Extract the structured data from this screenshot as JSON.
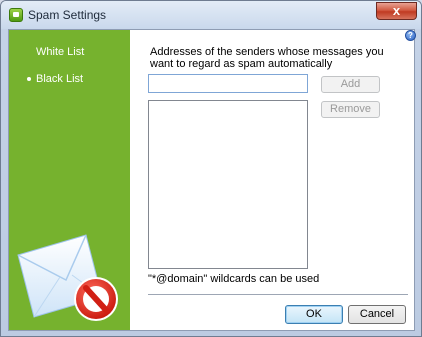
{
  "window": {
    "title": "Spam Settings",
    "close_glyph": "x",
    "help_glyph": "?"
  },
  "sidebar": {
    "background": "#76b22e",
    "items": [
      {
        "label": "White List",
        "selected": false
      },
      {
        "label": "Black List",
        "selected": true
      }
    ]
  },
  "main": {
    "description": "Addresses of the senders whose messages you want to regard as spam automatically",
    "address_input": {
      "value": "",
      "placeholder": ""
    },
    "add_label": "Add",
    "remove_label": "Remove",
    "wildcard_note": "\"*@domain\" wildcards can be used"
  },
  "footer": {
    "ok_label": "OK",
    "cancel_label": "Cancel"
  },
  "icons": {
    "app": "spam-settings-app-icon",
    "help": "help-icon",
    "art": "envelope-blocked-icon"
  }
}
